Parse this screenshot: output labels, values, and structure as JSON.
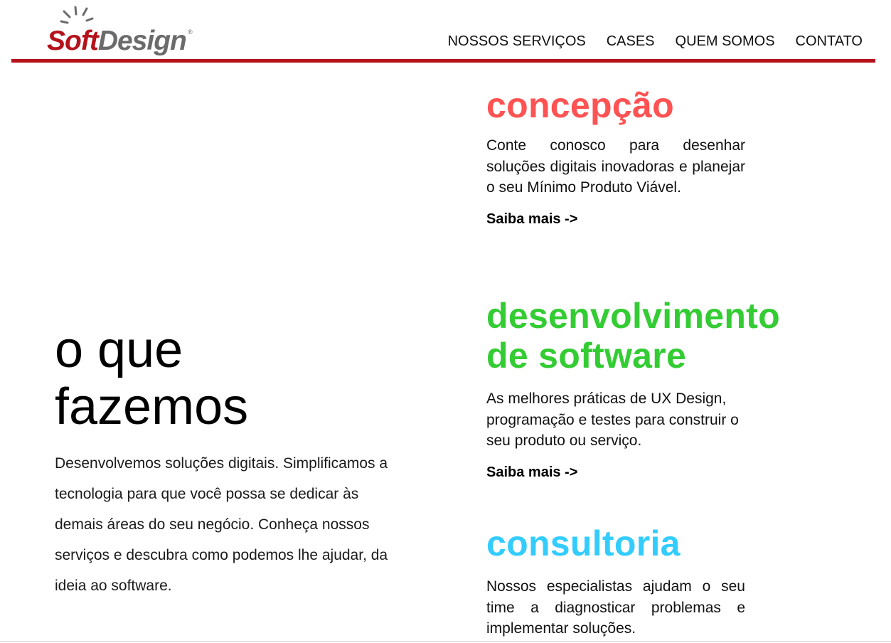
{
  "colors": {
    "brand_red": "#b5121b",
    "logo_gray": "#6b6b6b",
    "concepcao": "#ff5252",
    "desenvolvimento": "#33cc33",
    "consultoria": "#33ccff"
  },
  "header": {
    "logo": {
      "soft": "Soft",
      "design": "Design",
      "reg": "®"
    },
    "nav": [
      {
        "label": "NOSSOS SERVIÇOS"
      },
      {
        "label": "CASES"
      },
      {
        "label": "QUEM SOMOS"
      },
      {
        "label": "CONTATO"
      }
    ]
  },
  "intro": {
    "heading_line1": "o que",
    "heading_line2": "fazemos",
    "text": "Desenvolvemos soluções digitais. Simplificamos a tecnologia para que você possa se dedicar às demais áreas do seu negócio. Conheça nossos serviços e descubra como podemos lhe ajudar, da ideia ao software."
  },
  "services": [
    {
      "title": "concepção",
      "description": "Conte conosco para desenhar soluções digitais inovadoras e planejar o seu Mínimo Produto Viável.",
      "link": "Saiba mais ->"
    },
    {
      "title_line1": "desenvolvimento",
      "title_line2": "de software",
      "description": "As melhores práticas de UX Design, programação e testes para construir o seu produto ou serviço.",
      "link": "Saiba mais ->"
    },
    {
      "title": "consultoria",
      "description": "Nossos especialistas ajudam o seu time a diagnosticar problemas e implementar soluções."
    }
  ]
}
